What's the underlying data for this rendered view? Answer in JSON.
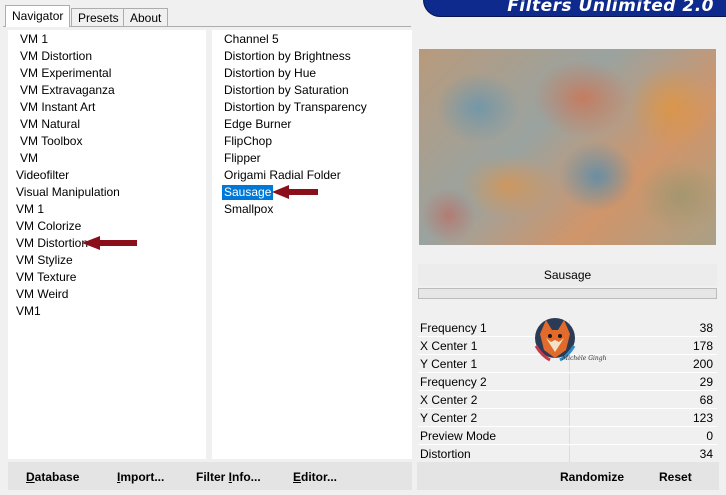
{
  "tabs": [
    {
      "label": "Navigator"
    },
    {
      "label": "Presets"
    },
    {
      "label": "About"
    }
  ],
  "banner": {
    "title": "Filters Unlimited 2.0"
  },
  "categories": [
    "VM 1",
    "VM Distortion",
    "VM Experimental",
    "VM Extravaganza",
    "VM Instant Art",
    "VM Natural",
    "VM Toolbox",
    "VM",
    "Videofilter",
    "Visual Manipulation",
    "VM 1",
    "VM Colorize",
    "VM Distortion",
    "VM Stylize",
    "VM Texture",
    "VM Weird",
    "VM1"
  ],
  "filters": [
    "Channel 5",
    "Distortion by Brightness",
    "Distortion by Hue",
    "Distortion by Saturation",
    "Distortion by Transparency",
    "Edge Burner",
    "FlipChop",
    "Flipper",
    "Origami Radial Folder",
    "Sausage",
    "Smallpox"
  ],
  "selected_filter_index": 9,
  "preview": {
    "filter_name": "Sausage"
  },
  "params": [
    {
      "name": "Frequency 1",
      "value": "38"
    },
    {
      "name": "X Center 1",
      "value": "178"
    },
    {
      "name": "Y Center 1",
      "value": "200"
    },
    {
      "name": "Frequency 2",
      "value": "29"
    },
    {
      "name": "X Center 2",
      "value": "68"
    },
    {
      "name": "Y Center 2",
      "value": "123"
    },
    {
      "name": "Preview Mode",
      "value": "0"
    },
    {
      "name": "Distortion",
      "value": "34"
    }
  ],
  "buttons": {
    "database": {
      "first": "D",
      "rest": "atabase"
    },
    "import": {
      "first": "I",
      "rest": "mport..."
    },
    "filter_info": {
      "before": "Filter ",
      "ul": "I",
      "after": "nfo..."
    },
    "editor": {
      "first": "E",
      "rest": "ditor..."
    },
    "randomize": "Randomize",
    "reset": "Reset"
  },
  "colors": {
    "selection": "#0078d7",
    "banner": "#0d2a8c",
    "arrow": "#8b0f1a"
  }
}
